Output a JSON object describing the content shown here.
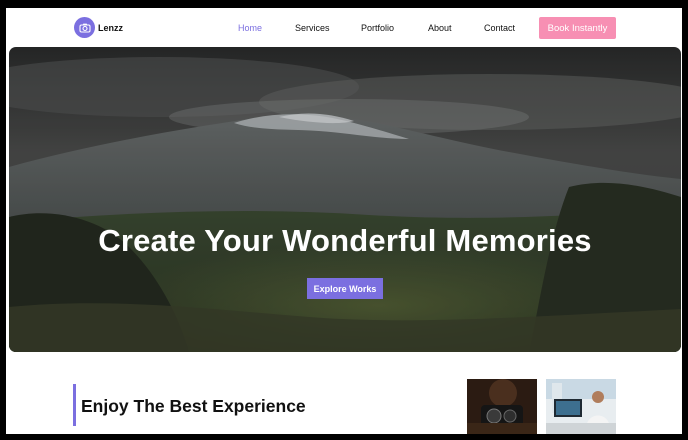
{
  "brand": {
    "name": "Lenzz",
    "icon": "camera-icon"
  },
  "nav": {
    "items": [
      {
        "label": "Home",
        "active": true
      },
      {
        "label": "Services",
        "active": false
      },
      {
        "label": "Portfolio",
        "active": false
      },
      {
        "label": "About",
        "active": false
      },
      {
        "label": "Contact",
        "active": false
      }
    ],
    "cta_label": "Book Instantly"
  },
  "hero": {
    "title": "Create Your Wonderful Memories",
    "button_label": "Explore Works"
  },
  "experience": {
    "title": "Enjoy The Best Experience"
  },
  "colors": {
    "accent": "#7b6fe0",
    "cta": "#f78fb3",
    "text": "#111111"
  }
}
